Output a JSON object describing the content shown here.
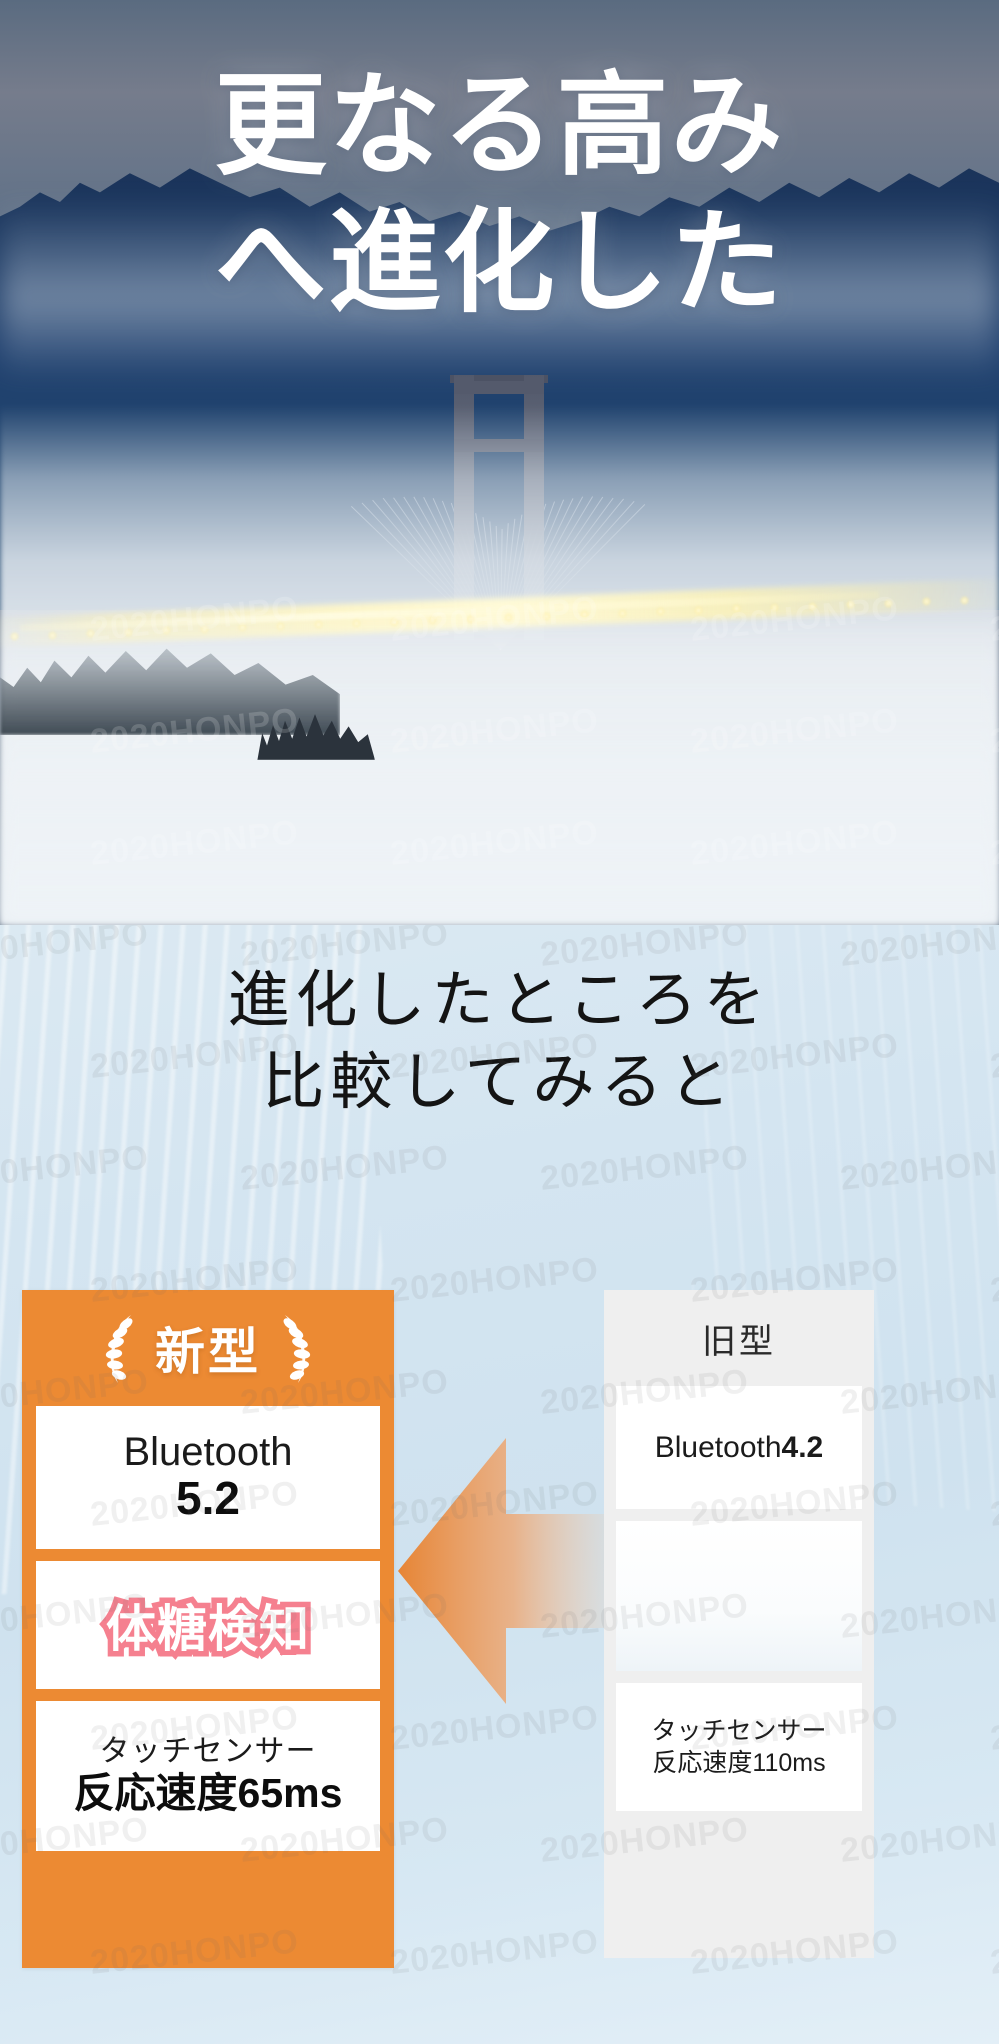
{
  "hero": {
    "title_line1": "更なる高み",
    "title_line2": "へ進化した"
  },
  "section": {
    "title_line1": "進化したところを",
    "title_line2": "比較してみると"
  },
  "comparison": {
    "arrow_direction": "left-arrow-icon",
    "new": {
      "badge_label": "新型",
      "badge_icon_left": "laurel-wreath-icon",
      "badge_icon_right": "laurel-wreath-icon",
      "rows": [
        {
          "label": "Bluetooth",
          "value": "5.2"
        },
        {
          "highlight": "体糖検知"
        },
        {
          "label": "タッチセンサー",
          "value": "反応速度65ms"
        }
      ]
    },
    "old": {
      "badge_label": "旧型",
      "rows": [
        {
          "label": "Bluetooth",
          "value": "4.2"
        },
        {
          "label": "",
          "value": ""
        },
        {
          "label": "タッチセンサー",
          "value": "反応速度110ms"
        }
      ]
    }
  },
  "watermark": {
    "text": "2020HONPO"
  },
  "colors": {
    "accent_orange": "#EC8A33",
    "highlight_pink": "#F5808F",
    "old_card_bg": "#EFEFEF",
    "section_bg": "#D4E5F1"
  }
}
